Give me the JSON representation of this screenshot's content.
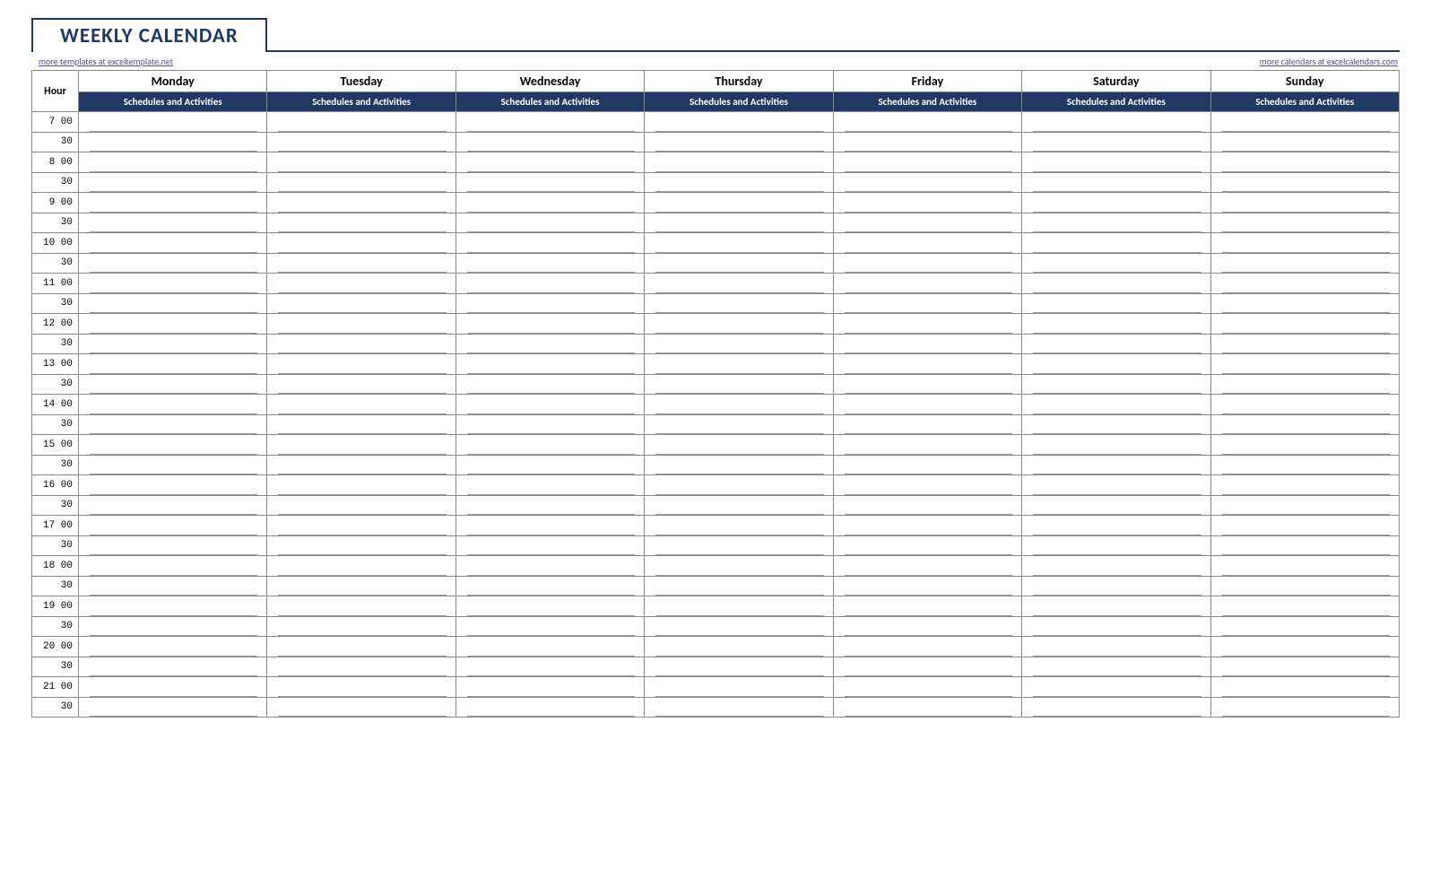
{
  "title": "WEEKLY CALENDAR",
  "links": {
    "left": "more templates at exceltemplate.net",
    "right": "more calendars at excelcalendars.com"
  },
  "hour_label": "Hour",
  "sub_header": "Schedules and Activities",
  "days": [
    "Monday",
    "Tuesday",
    "Wednesday",
    "Thursday",
    "Friday",
    "Saturday",
    "Sunday"
  ],
  "times": [
    "7  00",
    "30",
    "8  00",
    "30",
    "9  00",
    "30",
    "10  00",
    "30",
    "11  00",
    "30",
    "12  00",
    "30",
    "13  00",
    "30",
    "14  00",
    "30",
    "15  00",
    "30",
    "16  00",
    "30",
    "17  00",
    "30",
    "18  00",
    "30",
    "19  00",
    "30",
    "20  00",
    "30",
    "21  00",
    "30"
  ]
}
